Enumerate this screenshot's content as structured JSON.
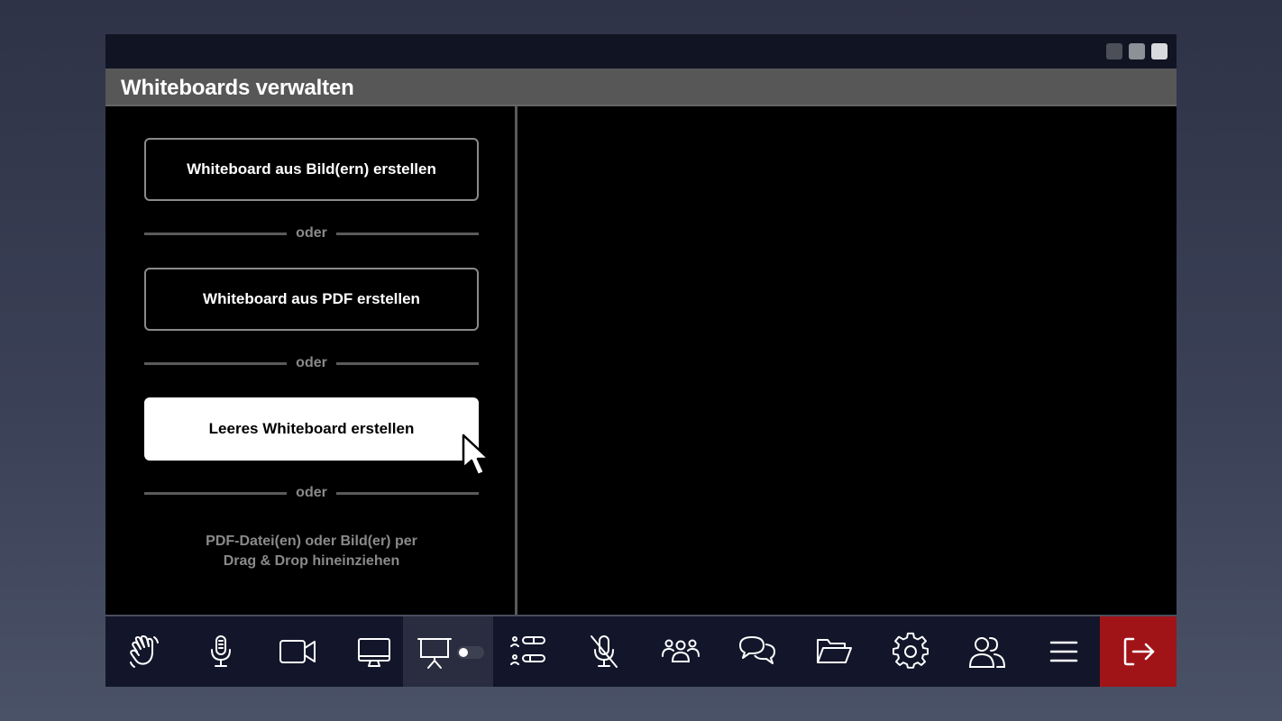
{
  "window": {
    "title": "Whiteboards verwalten"
  },
  "actions": {
    "from_images": "Whiteboard aus Bild(ern) erstellen",
    "separator": "oder",
    "from_pdf": "Whiteboard aus PDF erstellen",
    "blank": "Leeres Whiteboard erstellen",
    "drag_drop_line1": "PDF-Datei(en) oder Bild(er) per",
    "drag_drop_line2": "Drag & Drop hineinziehen"
  },
  "toolbar": {
    "items": [
      {
        "icon": "raise-hand-icon"
      },
      {
        "icon": "microphone-icon"
      },
      {
        "icon": "camera-icon"
      },
      {
        "icon": "screen-share-icon"
      },
      {
        "icon": "presentation-icon",
        "active": true,
        "toggle": "off"
      },
      {
        "icon": "poll-list-icon"
      },
      {
        "icon": "mute-all-icon"
      },
      {
        "icon": "participants-icon"
      },
      {
        "icon": "chat-icon"
      },
      {
        "icon": "folder-icon"
      },
      {
        "icon": "settings-icon"
      },
      {
        "icon": "breakout-rooms-icon"
      },
      {
        "icon": "menu-icon"
      },
      {
        "icon": "exit-icon"
      }
    ]
  },
  "colors": {
    "exit": "#a01418",
    "toolbar_bg": "#13162a",
    "header_bg": "#575757"
  }
}
